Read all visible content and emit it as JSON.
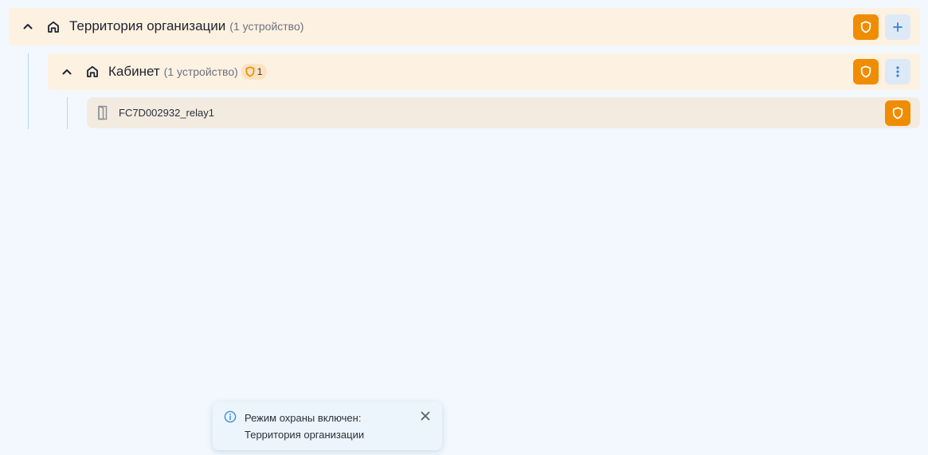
{
  "tree": {
    "organization": {
      "title": "Территория организации",
      "count": "(1 устройство)",
      "expand_icon": "chevron-up-icon",
      "type_icon": "home-icon",
      "actions": [
        {
          "icon": "shield-icon",
          "color": "#f08c00"
        },
        {
          "icon": "plus-icon",
          "color": "#dde9f7"
        }
      ]
    },
    "room": {
      "title": "Кабинет",
      "count": "(1 устройство)",
      "badge_count": "1",
      "expand_icon": "chevron-up-icon",
      "type_icon": "home-icon",
      "actions": [
        {
          "icon": "shield-icon",
          "color": "#f08c00"
        },
        {
          "icon": "more-vertical-icon",
          "color": "#dde9f7"
        }
      ]
    },
    "device": {
      "name": "FC7D002932_relay1",
      "type_icon": "door-icon",
      "actions": [
        {
          "icon": "shield-icon",
          "color": "#f08c00"
        }
      ]
    }
  },
  "toast": {
    "icon": "info-icon",
    "line1": "Режим охраны включен:",
    "line2": "Территория организации",
    "close_icon": "close-icon"
  },
  "colors": {
    "background": "#f2f8fe",
    "row_highlight": "#fdf1e1",
    "device_row": "#f4ebe0",
    "accent_orange": "#f08c00",
    "button_light": "#dde9f7",
    "tree_line": "#b9d3ee",
    "info_blue": "#3b8fe0"
  }
}
